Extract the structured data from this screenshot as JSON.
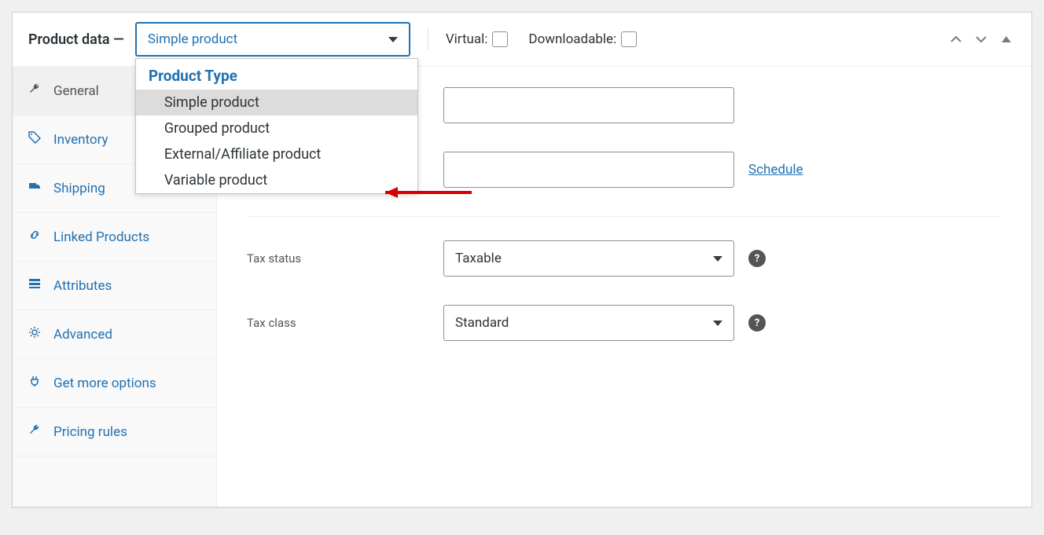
{
  "header": {
    "title": "Product data —",
    "select_value": "Simple product",
    "virtual_label": "Virtual:",
    "downloadable_label": "Downloadable:"
  },
  "dropdown": {
    "group_label": "Product Type",
    "options": [
      "Simple product",
      "Grouped product",
      "External/Affiliate product",
      "Variable product"
    ]
  },
  "tabs": [
    {
      "label": "General"
    },
    {
      "label": "Inventory"
    },
    {
      "label": "Shipping"
    },
    {
      "label": "Linked Products"
    },
    {
      "label": "Attributes"
    },
    {
      "label": "Advanced"
    },
    {
      "label": "Get more options"
    },
    {
      "label": "Pricing rules"
    }
  ],
  "fields": {
    "regular_price": "",
    "sale_price": "",
    "schedule_link": "Schedule",
    "tax_status_label": "Tax status",
    "tax_status_value": "Taxable",
    "tax_class_label": "Tax class",
    "tax_class_value": "Standard"
  },
  "colors": {
    "accent": "#2271b1",
    "panel_border": "#ccd0d4",
    "highlight": "#dcdcdc"
  }
}
